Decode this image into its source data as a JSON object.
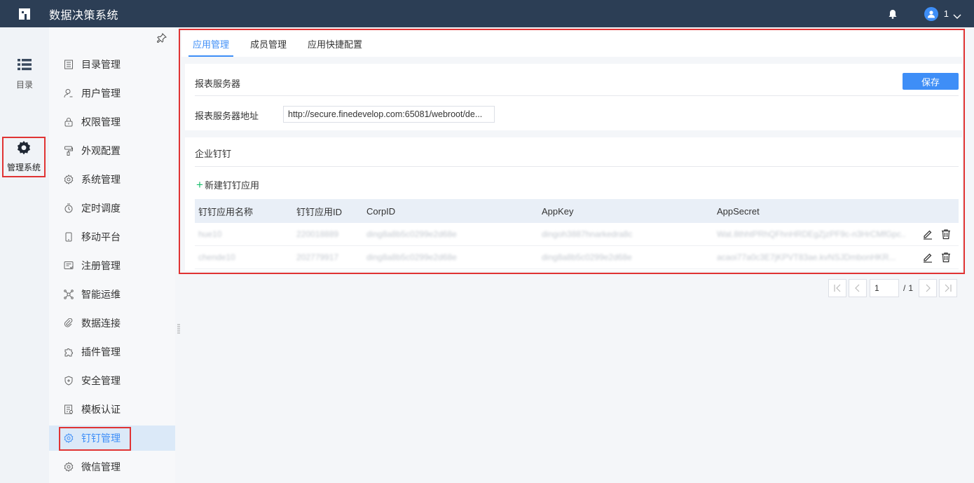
{
  "header": {
    "app_title": "数据决策系统",
    "user_name": "1"
  },
  "rail": {
    "catalog_label": "目录",
    "admin_label": "管理系统"
  },
  "menu": {
    "items": [
      {
        "label": "目录管理",
        "icon": "list-doc-icon"
      },
      {
        "label": "用户管理",
        "icon": "user-icon"
      },
      {
        "label": "权限管理",
        "icon": "lock-icon"
      },
      {
        "label": "外观配置",
        "icon": "brush-icon"
      },
      {
        "label": "系统管理",
        "icon": "gear-icon"
      },
      {
        "label": "定时调度",
        "icon": "timer-icon"
      },
      {
        "label": "移动平台",
        "icon": "mobile-icon"
      },
      {
        "label": "注册管理",
        "icon": "register-icon"
      },
      {
        "label": "智能运维",
        "icon": "network-icon"
      },
      {
        "label": "数据连接",
        "icon": "link-icon"
      },
      {
        "label": "插件管理",
        "icon": "puzzle-icon"
      },
      {
        "label": "安全管理",
        "icon": "shield-icon"
      },
      {
        "label": "模板认证",
        "icon": "template-icon"
      },
      {
        "label": "钉钉管理",
        "icon": "gear-icon"
      },
      {
        "label": "微信管理",
        "icon": "gear-icon"
      }
    ],
    "active_index": 13
  },
  "tabs": [
    "应用管理",
    "成员管理",
    "应用快捷配置"
  ],
  "active_tab": 0,
  "report_server": {
    "title": "报表服务器",
    "save_label": "保存",
    "address_label": "报表服务器地址",
    "address_value": "http://secure.finedevelop.com:65081/webroot/de..."
  },
  "dingtalk": {
    "title": "企业钉钉",
    "new_app_label": "新建钉钉应用",
    "columns": [
      "钉钉应用名称",
      "钉钉应用ID",
      "CorpID",
      "AppKey",
      "AppSecret"
    ],
    "rows": [
      [
        "hue10",
        "220018889",
        "ding8a8b5c0299e2d68e",
        "dingoh3887hnarkedra8c",
        "Wat.8thhtPRhQFhnHRDEgZjzPF9c-n3HrCMfGpc.."
      ],
      [
        "chende10",
        "202779917",
        "ding8a8b5c0299e2d68e",
        "ding8a8b5c0299e2d68e",
        "acaoi77a0c3E7jKPVT83ae.kvNSJDmbonHKR..."
      ]
    ]
  },
  "pager": {
    "current": "1",
    "separator": "/",
    "total": "1"
  },
  "colors": {
    "topbar": "#2c3e55",
    "accent": "#3e8ef7",
    "highlight_box": "#e03333",
    "add_green": "#19be6b"
  }
}
